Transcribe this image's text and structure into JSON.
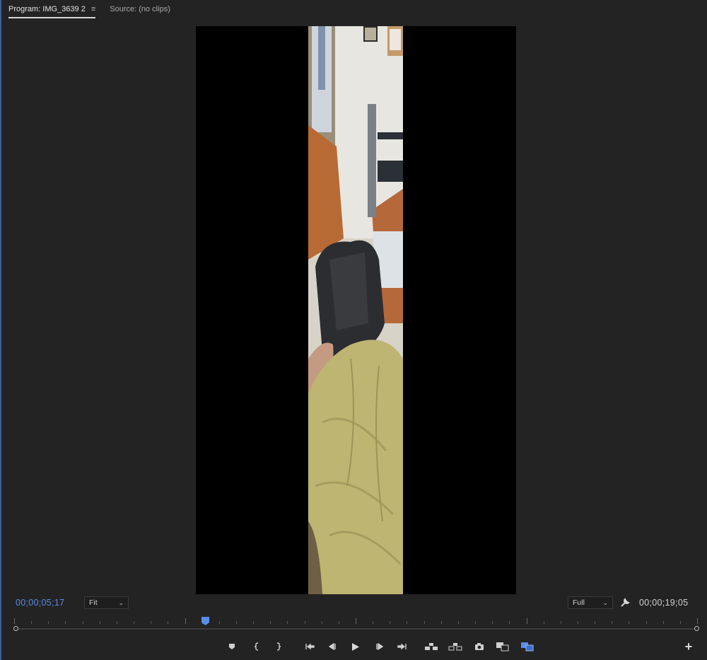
{
  "tabs": [
    {
      "label": "Program: IMG_3639 2",
      "active": true
    },
    {
      "label": "Source: (no clips)",
      "active": false
    }
  ],
  "tab_menu_icon": "hamburger-menu-icon",
  "timecode": {
    "current": "00;00;05;17",
    "duration": "00;00;19;05"
  },
  "zoom": {
    "selected": "Fit"
  },
  "resolution": {
    "selected": "Full"
  },
  "playhead_position": 0.28,
  "colors": {
    "accent": "#5b8ce8",
    "panel_bg": "#232323",
    "canvas_bg": "#000000"
  },
  "transport_icons": [
    "add-marker-icon",
    "mark-in-icon",
    "mark-out-icon",
    "go-to-in-icon",
    "step-back-icon",
    "play-icon",
    "step-forward-icon",
    "go-to-out-icon",
    "lift-icon",
    "extract-icon",
    "export-frame-icon",
    "insert-icon",
    "overwrite-icon"
  ],
  "add_button_icon": "plus-icon"
}
